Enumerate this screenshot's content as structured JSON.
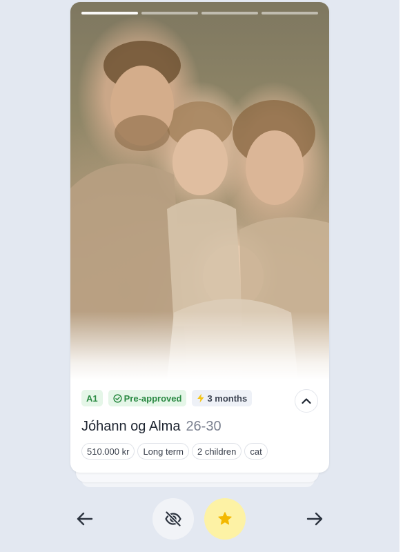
{
  "listing": {
    "photo": {
      "icon": "family-photo",
      "progress": {
        "segments": 4,
        "active_index": 0
      }
    },
    "badges": {
      "level": "A1",
      "approved": "Pre-approved",
      "duration": "3 months"
    },
    "name": "Jóhann og Alma",
    "age_range": "26-30",
    "tags": [
      "510.000 kr",
      "Long term",
      "2 children",
      "cat"
    ]
  },
  "actions": {
    "previous_icon": "arrow-left-icon",
    "hide_icon": "eye-off-icon",
    "favorite_icon": "star-icon",
    "next_icon": "arrow-right-icon"
  },
  "colors": {
    "background": "#e3e8f1",
    "success_text": "#2b8a43",
    "success_bg": "#e5f6e8",
    "duration_icon": "#f5c518",
    "favorite_bg": "#fdf2a5",
    "favorite_star": "#f3b800"
  }
}
